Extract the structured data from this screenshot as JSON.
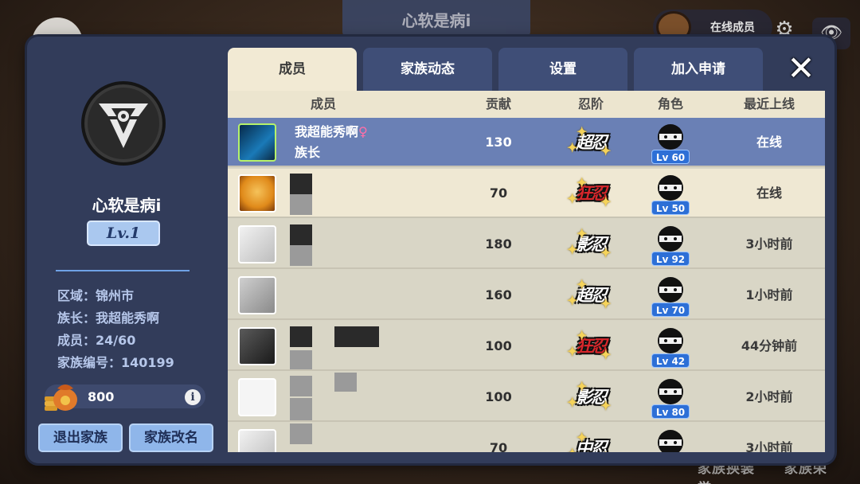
{
  "background": {
    "title": "心软是病i",
    "online_label": "在线成员",
    "bottom_buttons": [
      "家族换装",
      "家族荣誉"
    ]
  },
  "clan": {
    "name": "心软是病i",
    "level": "Lv.1",
    "region": "区域：锦州市",
    "leader": "族长：我超能秀啊",
    "members": "成员：24/60",
    "clan_id": "家族编号：140199",
    "coins": "800"
  },
  "buttons": {
    "leave": "退出家族",
    "rename": "家族改名"
  },
  "tabs": [
    {
      "label": "成员",
      "active": true
    },
    {
      "label": "家族动态",
      "active": false
    },
    {
      "label": "设置",
      "active": false
    },
    {
      "label": "加入申请",
      "active": false
    }
  ],
  "close_label": "✕",
  "table": {
    "headers": [
      "成员",
      "贡献",
      "忍阶",
      "角色",
      "最近上线"
    ],
    "rows": [
      {
        "name": "我超能秀啊",
        "role": "族长",
        "gender": "♀",
        "contribution": "130",
        "rank": "超忍",
        "level": "Lv 60",
        "last_online": "在线",
        "style": "self",
        "avatar": "blue"
      },
      {
        "name": "",
        "role": "",
        "gender": "",
        "contribution": "70",
        "rank": "狂忍",
        "level": "Lv 50",
        "last_online": "在线",
        "style": "alt",
        "avatar": "orange"
      },
      {
        "name": "",
        "role": "",
        "gender": "",
        "contribution": "180",
        "rank": "影忍",
        "level": "Lv 92",
        "last_online": "3小时前",
        "style": "plain",
        "avatar": "gray"
      },
      {
        "name": "",
        "role": "",
        "gender": "",
        "contribution": "160",
        "rank": "超忍",
        "level": "Lv 70",
        "last_online": "1小时前",
        "style": "plain",
        "avatar": "gray2"
      },
      {
        "name": "",
        "role": "",
        "gender": "",
        "contribution": "100",
        "rank": "狂忍",
        "level": "Lv 42",
        "last_online": "44分钟前",
        "style": "plain",
        "avatar": "dark"
      },
      {
        "name": "",
        "role": "",
        "gender": "",
        "contribution": "100",
        "rank": "影忍",
        "level": "Lv 80",
        "last_online": "2小时前",
        "style": "plain",
        "avatar": "white"
      },
      {
        "name": "",
        "role": "",
        "gender": "",
        "contribution": "70",
        "rank": "中忍",
        "level": "",
        "last_online": "3小时前",
        "style": "plain",
        "avatar": "gray"
      }
    ]
  },
  "colors": {
    "panel": "#323c5a",
    "tab_active": "#f2ead4",
    "self_row": "#6a80b5",
    "level_badge": "#2d6fd6"
  }
}
